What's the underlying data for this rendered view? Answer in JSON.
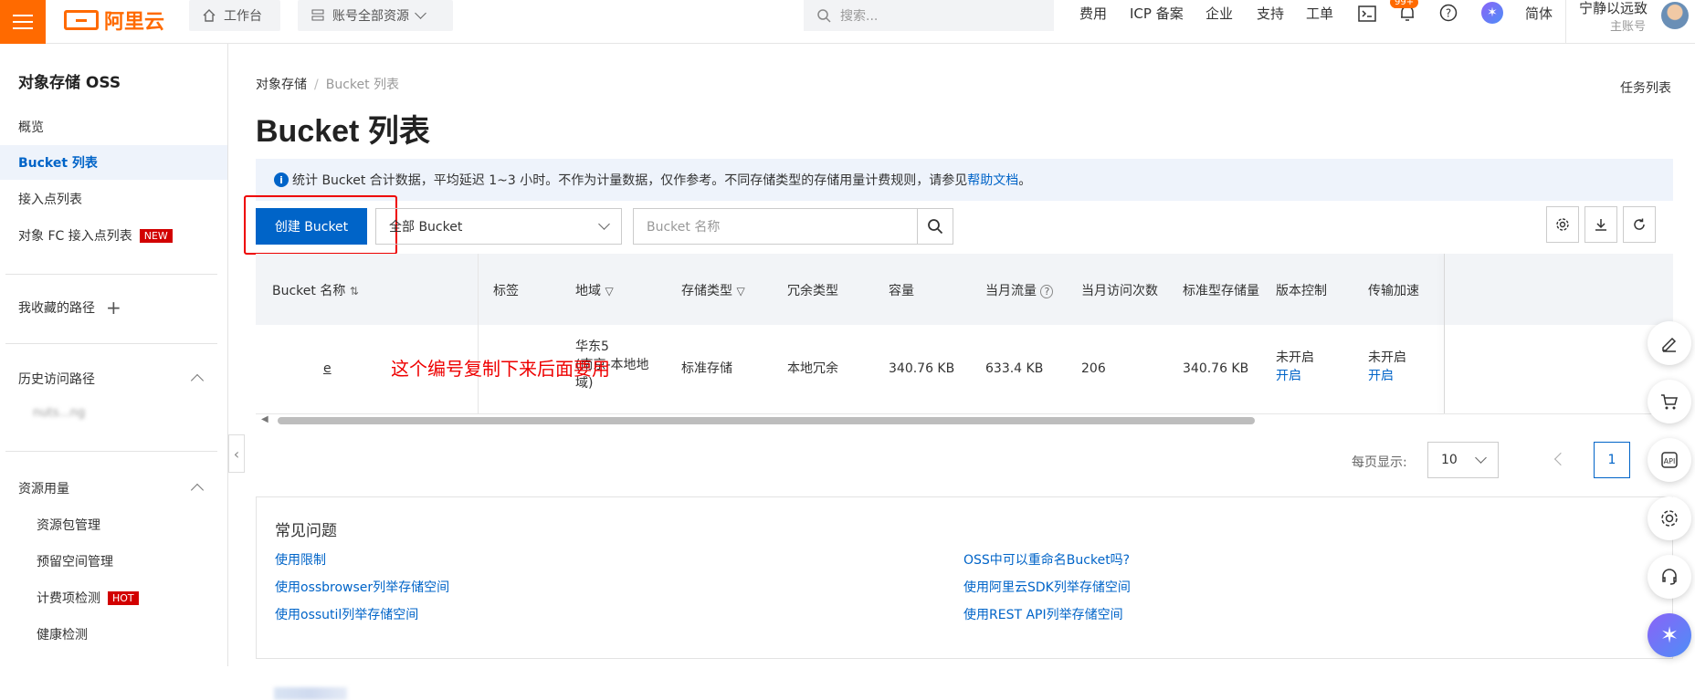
{
  "topbar": {
    "logo_text": "阿里云",
    "workbench": "工作台",
    "resources": "账号全部资源",
    "search_placeholder": "搜索...",
    "nav": [
      "费用",
      "ICP 备案",
      "企业",
      "支持",
      "工单"
    ],
    "badge": "99+",
    "lang": "简体",
    "user_name": "宁静以远致",
    "user_role": "主账号"
  },
  "sidebar": {
    "title": "对象存储 OSS",
    "items": [
      {
        "label": "概览"
      },
      {
        "label": "Bucket 列表"
      },
      {
        "label": "接入点列表"
      },
      {
        "label": "对象 FC 接入点列表",
        "tag": "NEW"
      }
    ],
    "favorites": "我收藏的路径",
    "history": "历史访问路径",
    "history_item": "nuts...ng",
    "usage": "资源用量",
    "usage_items": [
      {
        "label": "资源包管理"
      },
      {
        "label": "预留空间管理"
      },
      {
        "label": "计费项检测",
        "tag": "HOT"
      },
      {
        "label": "健康检测"
      }
    ]
  },
  "main": {
    "breadcrumb": [
      "对象存储",
      "Bucket 列表"
    ],
    "tasks": "任务列表",
    "title": "Bucket 列表",
    "info_text": "统计 Bucket 合计数据，平均延迟 1~3 小时。不作为计量数据，仅作参考。不同存储类型的存储用量计费规则，请参见",
    "info_link": "帮助文档",
    "info_end": "。",
    "create_button": "创建 Bucket",
    "filter_select": "全部 Bucket",
    "name_placeholder": "Bucket 名称",
    "columns": [
      "Bucket 名称",
      "标签",
      "地域",
      "存储类型",
      "冗余类型",
      "容量",
      "当月流量",
      "当月访问次数",
      "标准型存储量",
      "版本控制",
      "传输加速"
    ],
    "row": {
      "name": "e",
      "region": [
        "华东5",
        "(南京-本地地",
        "域)"
      ],
      "storage_type": "标准存储",
      "redundancy": "本地冗余",
      "capacity": "340.76 KB",
      "traffic": "633.4 KB",
      "visits": "206",
      "std_storage": "340.76 KB",
      "versioning": "未开启",
      "versioning_action": "开启",
      "accel": "未开启",
      "accel_action": "开启"
    },
    "annotation": "这个编号复制下来后面要用",
    "page_size_label": "每页显示:",
    "page_size": "10",
    "page": "1"
  },
  "faq": {
    "title": "常见问题",
    "links_left": [
      "使用限制",
      "使用ossbrowser列举存储空间",
      "使用ossutil列举存储空间"
    ],
    "links_right": [
      "OSS中可以重命名Bucket吗?",
      "使用阿里云SDK列举存储空间",
      "使用REST API列举存储空间"
    ]
  },
  "colors": {
    "brand": "#ff6a00",
    "primary": "#0064c8",
    "tag_red": "#d20000",
    "annotation": "#e00000"
  }
}
